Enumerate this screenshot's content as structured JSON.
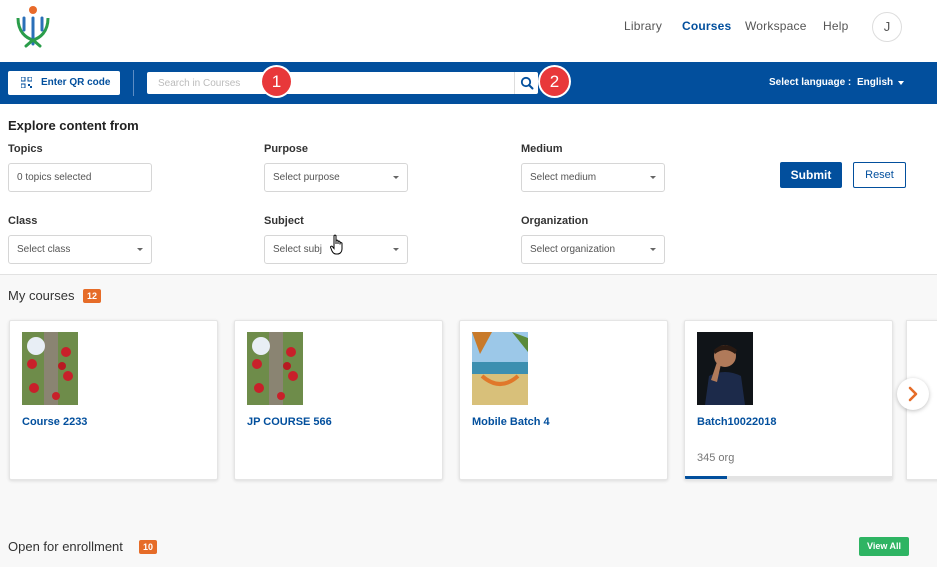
{
  "header": {
    "logo_icon": "diksha-logo-icon",
    "nav": [
      {
        "label": "Library",
        "active": false
      },
      {
        "label": "Courses",
        "active": true
      },
      {
        "label": "Workspace",
        "active": false
      },
      {
        "label": "Help",
        "active": false
      }
    ],
    "avatar_initial": "J"
  },
  "toolbar": {
    "qr_button_label": "Enter QR code",
    "qr_icon": "qr-code-icon",
    "search_placeholder": "Search in Courses",
    "search_icon": "search-icon",
    "callout_1": "1",
    "callout_2": "2",
    "language_label": "Select language :",
    "language_value": "English"
  },
  "filters": {
    "title": "Explore content from",
    "topics": {
      "label": "Topics",
      "value": "0 topics selected"
    },
    "purpose": {
      "label": "Purpose",
      "value": "Select purpose"
    },
    "medium": {
      "label": "Medium",
      "value": "Select medium"
    },
    "class": {
      "label": "Class",
      "value": "Select class"
    },
    "subject": {
      "label": "Subject",
      "value": "Select subj"
    },
    "organization": {
      "label": "Organization",
      "value": "Select organization"
    },
    "submit_label": "Submit",
    "reset_label": "Reset"
  },
  "my_courses": {
    "title": "My courses",
    "count": "12",
    "cards": [
      {
        "title": "Course 2233",
        "subtitle": "",
        "thumb": "tulip-tree-thumbnail"
      },
      {
        "title": "JP COURSE 566",
        "subtitle": "",
        "thumb": "tulip-tree-thumbnail"
      },
      {
        "title": "Mobile Batch 4",
        "subtitle": "",
        "thumb": "hammock-beach-thumbnail"
      },
      {
        "title": "Batch10022018",
        "subtitle": "345 org",
        "thumb": "tennis-player-thumbnail",
        "progress": 0.2
      }
    ]
  },
  "open_enrollment": {
    "title": "Open for enrollment",
    "count": "10",
    "view_all_label": "View All"
  },
  "colors": {
    "brand_blue": "#024f9d",
    "badge_orange": "#e66c28",
    "callout_red": "#e8383a",
    "view_all_green": "#2eb463"
  }
}
